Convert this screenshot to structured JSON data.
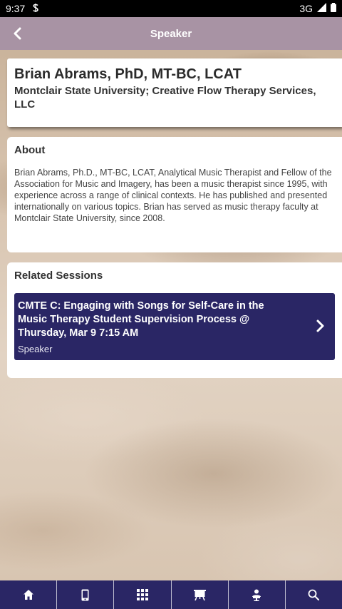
{
  "status_bar": {
    "time": "9:37",
    "network": "3G"
  },
  "header": {
    "title": "Speaker"
  },
  "speaker": {
    "name": "Brian Abrams, PhD, MT-BC, LCAT",
    "affiliation": "Montclair State University; Creative Flow Therapy Services, LLC"
  },
  "about": {
    "title": "About",
    "text": "Brian Abrams, Ph.D., MT-BC, LCAT, Analytical Music Therapist and Fellow of the Association for Music and Imagery, has been a music therapist since 1995, with experience across a range of clinical contexts. He has published and presented internationally on various topics. Brian has served as music therapy faculty at Montclair State University, since 2008."
  },
  "related": {
    "title": "Related Sessions",
    "sessions": [
      {
        "title": "CMTE C: Engaging with Songs for Self-Care in the Music Therapy Student Supervision Process @ Thursday, Mar 9 7:15 AM",
        "role": "Speaker"
      }
    ]
  },
  "bottom_nav": {
    "items": [
      {
        "icon": "home-icon"
      },
      {
        "icon": "mobile-icon"
      },
      {
        "icon": "grid-icon"
      },
      {
        "icon": "presentation-icon"
      },
      {
        "icon": "speaker-icon"
      },
      {
        "icon": "search-icon"
      }
    ]
  },
  "colors": {
    "header": "#a893a4",
    "nav": "#2a2665",
    "session": "#2a2665"
  }
}
